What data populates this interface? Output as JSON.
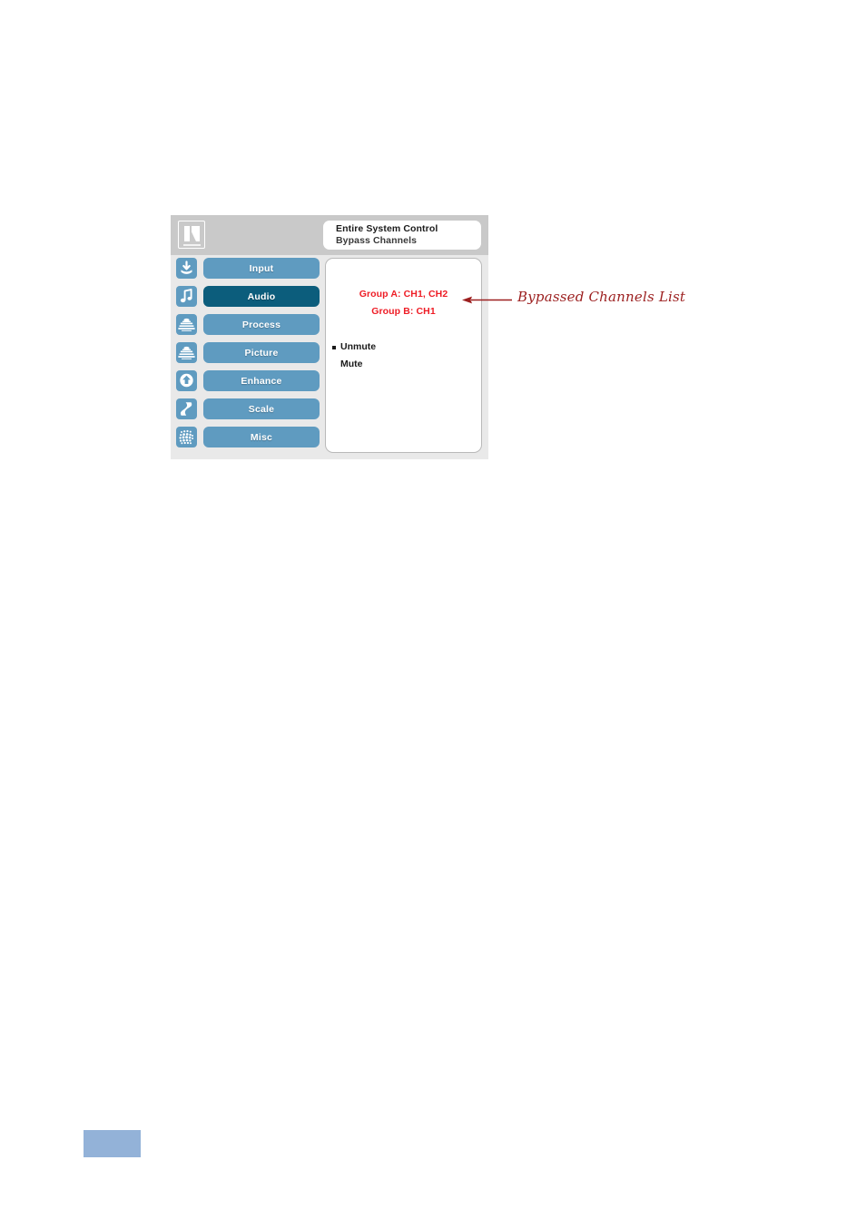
{
  "device": {
    "brand_logo": "kramer-logo",
    "header": {
      "title_line1": "Entire System Control",
      "title_line2": "Bypass Channels"
    },
    "menu": [
      {
        "label": "Input",
        "icon": "input-download-icon",
        "selected": false
      },
      {
        "label": "Audio",
        "icon": "audio-note-icon",
        "selected": true
      },
      {
        "label": "Process",
        "icon": "process-layers-icon",
        "selected": false
      },
      {
        "label": "Picture",
        "icon": "picture-layers-icon",
        "selected": false
      },
      {
        "label": "Enhance",
        "icon": "enhance-arrow-icon",
        "selected": false
      },
      {
        "label": "Scale",
        "icon": "scale-diagonal-icon",
        "selected": false
      },
      {
        "label": "Misc",
        "icon": "misc-grid-icon",
        "selected": false
      }
    ],
    "content": {
      "bypass_lines": [
        "Group A: CH1, CH2",
        "Group B: CH1"
      ],
      "mute_options": [
        {
          "label": "Unmute",
          "selected": true
        },
        {
          "label": "Mute",
          "selected": false
        }
      ]
    }
  },
  "annotation": {
    "label": "Bypassed Channels List",
    "arrow": "left-arrow-icon"
  },
  "colors": {
    "button_blue": "#5f9bc0",
    "button_selected": "#0c5d7c",
    "header_gray": "#c9c9c9",
    "panel_gray": "#e9e9e9",
    "bypass_red": "#ee1c25",
    "annotation_red": "#9c1f1f",
    "page_marker_blue": "#93b2d8"
  }
}
